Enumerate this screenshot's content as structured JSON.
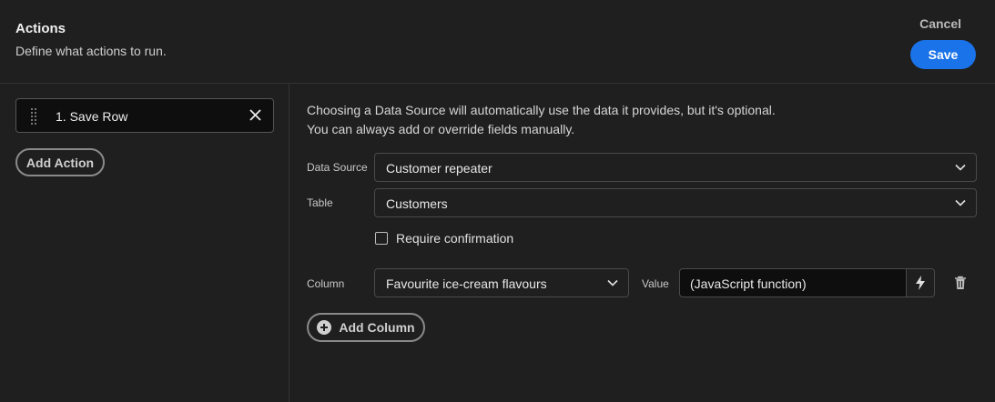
{
  "header": {
    "title": "Actions",
    "subtitle": "Define what actions to run.",
    "cancel_label": "Cancel",
    "save_label": "Save"
  },
  "left_panel": {
    "actions": [
      {
        "label": "1. Save Row"
      }
    ],
    "add_action_label": "Add Action"
  },
  "main": {
    "info_line_1": "Choosing a Data Source will automatically use the data it provides, but it's optional.",
    "info_line_2": "You can always add or override fields manually.",
    "data_source": {
      "label": "Data Source",
      "value": "Customer repeater"
    },
    "table": {
      "label": "Table",
      "value": "Customers"
    },
    "require_confirmation": {
      "label": "Require confirmation",
      "checked": false
    },
    "column_row": {
      "column_label": "Column",
      "column_value": "Favourite ice-cream flavours",
      "value_label": "Value",
      "value_value": "(JavaScript function)"
    },
    "add_column_label": "Add Column"
  },
  "colors": {
    "background": "#1f1f1f",
    "accent": "#1a73e8",
    "input_dark": "#0e0e0e",
    "border": "#4a4a4a"
  },
  "icons": [
    "drag-handle-icon",
    "close-icon",
    "chevron-down-icon",
    "lightning-bolt-icon",
    "trash-icon",
    "plus-circle-icon"
  ]
}
